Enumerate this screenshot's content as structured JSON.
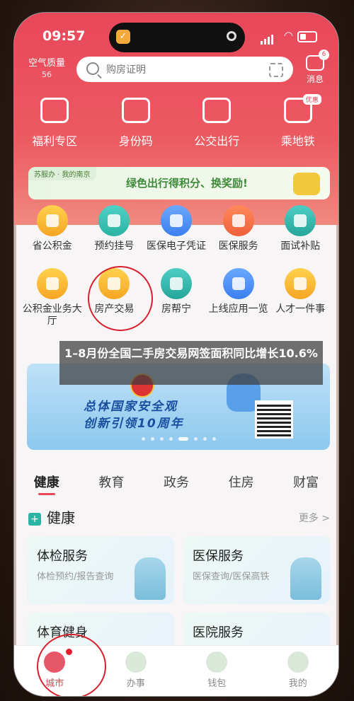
{
  "status": {
    "time": "09:57"
  },
  "header": {
    "air_quality_label": "空气质量",
    "air_quality_value": "56",
    "search_placeholder": "购房证明",
    "messages_label": "消息",
    "messages_badge": "6"
  },
  "quick_actions": [
    {
      "label": "福利专区"
    },
    {
      "label": "身份码"
    },
    {
      "label": "公交出行"
    },
    {
      "label": "乘地铁",
      "tag": "优惠"
    }
  ],
  "banner_green": {
    "source": "苏服办 · 我的南京",
    "text": "绿色出行得积分、换奖励!"
  },
  "services": [
    {
      "label": "省公积金"
    },
    {
      "label": "预约挂号"
    },
    {
      "label": "医保电子凭证"
    },
    {
      "label": "医保服务"
    },
    {
      "label": "面试补贴"
    },
    {
      "label": "公积金业务大厅"
    },
    {
      "label": "房产交易"
    },
    {
      "label": "房帮宁"
    },
    {
      "label": "上线应用一览"
    },
    {
      "label": "人才一件事"
    }
  ],
  "overlay_caption": "1–8月份全国二手房交易网签面积同比增长10.6%",
  "banner_blue": {
    "line1": "总体国家安全观",
    "line2": "创新引领10周年"
  },
  "categories": [
    "健康",
    "教育",
    "政务",
    "住房",
    "财富"
  ],
  "active_category": "健康",
  "section": {
    "title": "健康",
    "more": "更多 >"
  },
  "cards": [
    {
      "title": "体检服务",
      "subtitle": "体检预约/报告查询"
    },
    {
      "title": "医保服务",
      "subtitle": "医保查询/医保高铁"
    },
    {
      "title": "体育健身",
      "subtitle": ""
    },
    {
      "title": "医院服务",
      "subtitle": ""
    }
  ],
  "tabbar": [
    {
      "label": "城市"
    },
    {
      "label": "办事"
    },
    {
      "label": "钱包"
    },
    {
      "label": "我的"
    }
  ],
  "colors": {
    "brand": "#e8475a",
    "annotation": "#d81e2c"
  }
}
